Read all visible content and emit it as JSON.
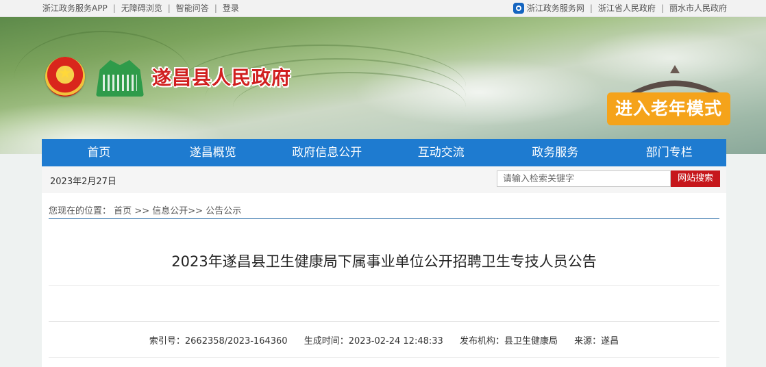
{
  "topbar": {
    "left_links": [
      "浙江政务服务APP",
      "无障碍浏览",
      "智能问答",
      "登录"
    ],
    "right_links": [
      "浙江政务服务网",
      "浙江省人民政府",
      "丽水市人民政府"
    ]
  },
  "header": {
    "site_title": "遂昌县人民政府",
    "elderly_mode_label": "进入老年模式"
  },
  "nav": {
    "items": [
      "首页",
      "遂昌概览",
      "政府信息公开",
      "互动交流",
      "政务服务",
      "部门专栏"
    ]
  },
  "infobar": {
    "date": "2023年2月27日",
    "search_placeholder": "请输入检索关键字",
    "search_button": "网站搜索"
  },
  "breadcrumb": {
    "prefix": "您现在的位置：",
    "items": [
      "首页",
      "信息公开",
      "公告公示"
    ],
    "separator": ">>"
  },
  "article": {
    "title": "2023年遂昌县卫生健康局下属事业单位公开招聘卫生专技人员公告",
    "meta": {
      "index_label": "索引号：",
      "index_value": "2662358/2023-164360",
      "time_label": "生成时间：",
      "time_value": "2023-02-24 12:48:33",
      "org_label": "发布机构：",
      "org_value": "县卫生健康局",
      "source_label": "来源：",
      "source_value": "遂昌"
    }
  },
  "colors": {
    "nav_blue": "#1e7bd0",
    "title_red": "#d01f1f",
    "search_red": "#c6171c",
    "elderly_orange": "#f5a31a"
  }
}
